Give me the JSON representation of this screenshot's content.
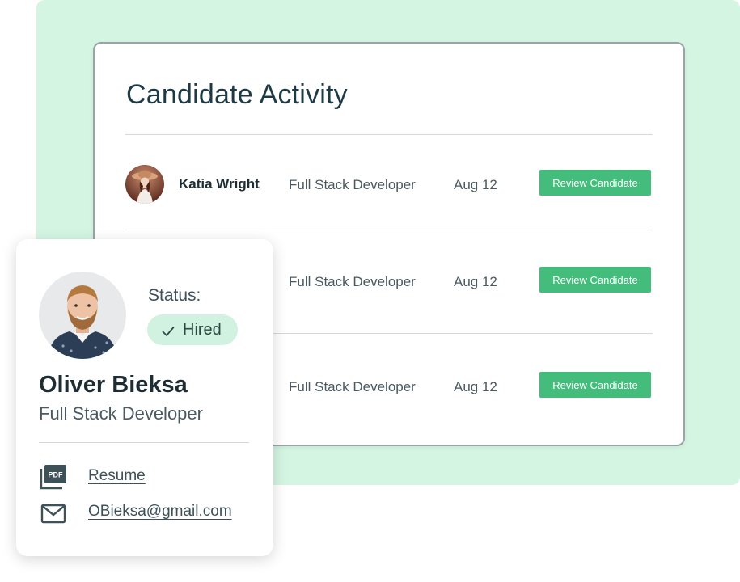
{
  "activity": {
    "title": "Candidate Activity",
    "rows": [
      {
        "name": "Katia Wright",
        "role": "Full Stack Developer",
        "date": "Aug 12",
        "action": "Review Candidate"
      },
      {
        "name": "",
        "role": "Full Stack Developer",
        "date": "Aug 12",
        "action": "Review Candidate"
      },
      {
        "name": "",
        "role": "Full Stack Developer",
        "date": "Aug 12",
        "action": "Review Candidate"
      }
    ]
  },
  "profile": {
    "name": "Oliver Bieksa",
    "role": "Full Stack Developer",
    "status_label": "Status:",
    "status_value": "Hired",
    "resume_label": "Resume",
    "email": "OBieksa@gmail.com"
  },
  "colors": {
    "mint_background": "#d5f5e3",
    "button_green": "#44bc7c",
    "badge_green": "#d2f2e1",
    "title_text": "#1e3a45"
  },
  "icons": {
    "status_check": "check-icon",
    "resume": "pdf-icon",
    "email": "mail-icon"
  }
}
